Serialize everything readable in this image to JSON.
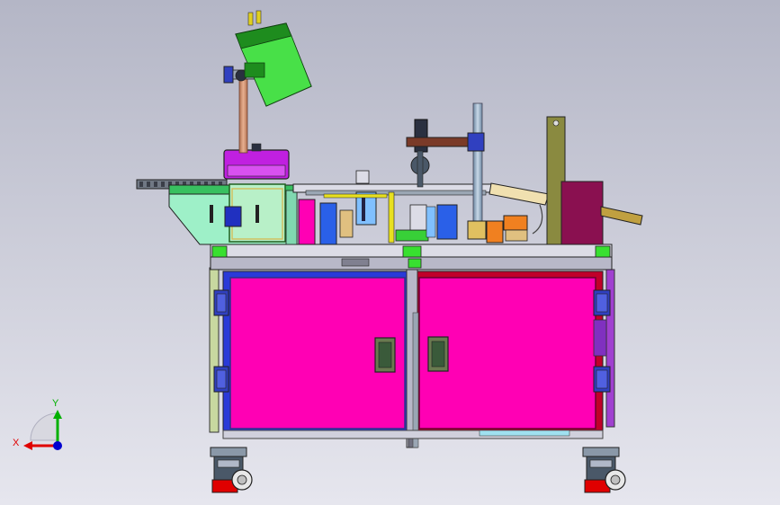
{
  "viewport": {
    "background_top": "#b4b6c6",
    "background_bottom": "#e6e6ee"
  },
  "axis_triad": {
    "x_label": "X",
    "y_label": "Y",
    "x_color": "#e00000",
    "y_color": "#00b000",
    "z_color": "#0000d0"
  },
  "colors": {
    "cabinet_magenta": "#ff00b4",
    "cabinet_frame_blue": "#2a3ad8",
    "cabinet_frame_red": "#c0002a",
    "light_green": "#b8f0c8",
    "mint": "#9ef0c8",
    "bright_green": "#38e030",
    "purple": "#c020e0",
    "dark_green": "#1e8c1e",
    "steel_gray": "#9aa6b4",
    "tan": "#e0c080",
    "orange": "#f08020",
    "dark_magenta": "#8a1050",
    "olive": "#8a8a40",
    "caster_red": "#e00000"
  }
}
